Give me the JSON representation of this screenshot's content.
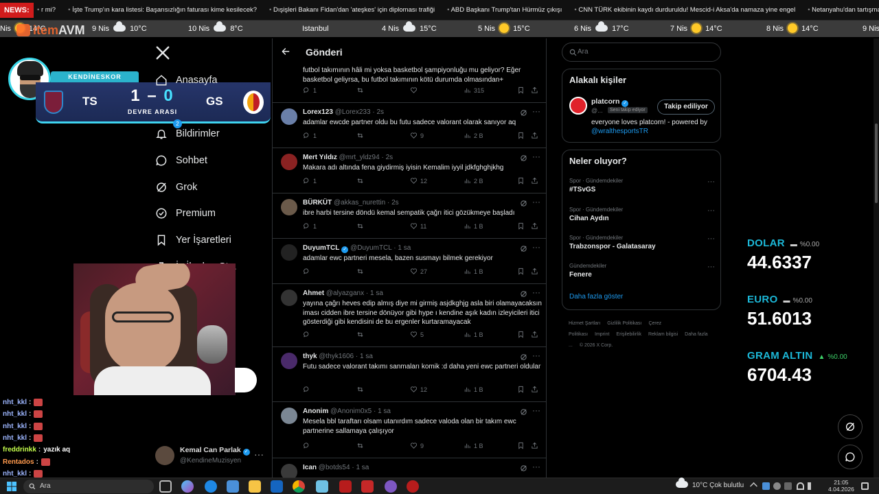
{
  "news": {
    "label": "NEWS:",
    "items": [
      "r mi?",
      "İşte Trump'ın kara listesi: Başarısızlığın faturası kime kesilecek?",
      "Dışişleri Bakanı Fidan'dan 'ateşkes' için diploması trafiği",
      "ABD Başkanı Trump'tan Hürmüz çıkışı",
      "CNN TÜRK ekibinin kaydı durduruldu! Mescid-i Aksa'da namaza yine engel",
      "Netanyahu'dan tartışma yaratacak sözler: \"Altyapıları bombalıyo"
    ]
  },
  "weather": [
    {
      "day": "Nis",
      "temp": "14°C",
      "icon": "sun-icon"
    },
    {
      "day": "9 Nis",
      "temp": "10°C",
      "icon": "cloud-icon"
    },
    {
      "day": "10 Nis",
      "temp": "8°C",
      "icon": "cloud-icon"
    },
    {
      "day": "Istanbul",
      "temp": "",
      "icon": ""
    },
    {
      "day": "4 Nis",
      "temp": "15°C",
      "icon": "cloud-icon"
    },
    {
      "day": "5 Nis",
      "temp": "15°C",
      "icon": "sun-icon"
    },
    {
      "day": "6 Nis",
      "temp": "17°C",
      "icon": "cloud-icon"
    },
    {
      "day": "7 Nis",
      "temp": "14°C",
      "icon": "sun-icon"
    },
    {
      "day": "8 Nis",
      "temp": "14°C",
      "icon": "sun-icon"
    },
    {
      "day": "9 Nis",
      "temp": "",
      "icon": "cloud-icon"
    }
  ],
  "overlay": {
    "logo_item": "item",
    "logo_avm": "AVM",
    "score_title": "KENDİNESKOR",
    "home_team": "TS",
    "away_team": "GS",
    "home_score": "1",
    "away_score": "0",
    "status": "DEVRE ARASI"
  },
  "nav": {
    "items": [
      {
        "label": "Anasayfa",
        "icon": "home-icon"
      },
      {
        "label": "Bildirimler",
        "icon": "bell-icon",
        "badge": "2"
      },
      {
        "label": "Sohbet",
        "icon": "chat-icon"
      },
      {
        "label": "Grok",
        "icon": "grok-icon"
      },
      {
        "label": "Premium",
        "icon": "premium-icon"
      },
      {
        "label": "Yer İşaretleri",
        "icon": "bookmark-icon"
      },
      {
        "label": "İş İlanları St...",
        "icon": "briefcase-icon"
      }
    ],
    "account_name": "Kemal Can Parlak",
    "account_handle": "@KendineMuzisyen",
    "account_more": "···"
  },
  "chat": [
    {
      "user": "nht_kkl",
      "msg": "",
      "cls": ""
    },
    {
      "user": "nht_kkl",
      "msg": "",
      "cls": ""
    },
    {
      "user": "nht_kkl",
      "msg": "",
      "cls": ""
    },
    {
      "user": "nht_kkl",
      "msg": "",
      "cls": ""
    },
    {
      "user": "freddrinkk",
      "msg": "yazık aq",
      "cls": "c2"
    },
    {
      "user": "Rentados",
      "msg": "",
      "cls": "c3"
    },
    {
      "user": "nht_kkl",
      "msg": "",
      "cls": ""
    }
  ],
  "timeline": {
    "title": "Gönderi",
    "tweets": [
      {
        "name": "",
        "handle": "",
        "time": "",
        "verified": false,
        "avatar": "#444",
        "text": "futbol takımının hâli mi yoksa basketbol şampiyonluğu mu geliyor? Eğer basketbol geliyrsa, bu futbol takımının kötü durumda olmasından+",
        "replies": "1",
        "retweets": "",
        "likes": "",
        "views": "315"
      },
      {
        "name": "Lorex123",
        "handle": "@Lorex233",
        "time": "2s",
        "verified": false,
        "avatar": "#6a7fa8",
        "text": "adamlar ewcde partner oldu bu futu  sadece valorant olarak sanıyor aq",
        "replies": "1",
        "retweets": "",
        "likes": "9",
        "views": "2 B"
      },
      {
        "name": "Mert Yıldız",
        "handle": "@mrt_yldz94",
        "time": "2s",
        "verified": false,
        "avatar": "#8a2222",
        "text": "Makara adı altında fena giydirmiş iyisin Kemalim iyyil jdkfghghjkhg",
        "replies": "1",
        "retweets": "",
        "likes": "12",
        "views": "2 B"
      },
      {
        "name": "BÜRKÜT",
        "handle": "@akkas_nurettin",
        "time": "2s",
        "verified": false,
        "avatar": "#6b5a4a",
        "text": "ibre harbi tersine döndü kemal sempatik çağrı itici gözükmeye başladı",
        "replies": "1",
        "retweets": "",
        "likes": "11",
        "views": "1 B"
      },
      {
        "name": "DuyumTCL",
        "handle": "@DuyumTCL",
        "time": "1 sa",
        "verified": true,
        "avatar": "#222",
        "text": "adamlar ewc partneri mesela, bazen susmayı bilmek gerekiyor",
        "replies": "",
        "retweets": "",
        "likes": "27",
        "views": "1 B"
      },
      {
        "name": "Ahmet",
        "handle": "@alyazganx",
        "time": "1 sa",
        "verified": false,
        "avatar": "#333",
        "text": "yayına çağrı heves edip almış diye mi girmiş asjdkghjg asla biri olamayacaksın iması cidden ibre tersine dönüyor gibi hype ı kendine aşık kadın izleyicileri itici gösterdiği gibi kendisini de bu ergenler kurtaramayacak",
        "replies": "",
        "retweets": "",
        "likes": "5",
        "views": "1 B"
      },
      {
        "name": "thyk",
        "handle": "@thyk1606",
        "time": "1 sa",
        "verified": false,
        "avatar": "#4a2a6a",
        "text": "Futu sadece valorant takımı sanmaları komik :d daha yeni ewc partneri oldular",
        "replies": "",
        "retweets": "",
        "likes": "12",
        "views": "1 B"
      },
      {
        "name": "Anonim",
        "handle": "@Anonim0x5",
        "time": "1 sa",
        "verified": false,
        "avatar": "#7b8794",
        "text": "Mesela bbl taraftarı olsam utanırdım sadece valoda olan bir takım ewc partnerine sallamaya çalışıyor",
        "replies": "",
        "retweets": "",
        "likes": "9",
        "views": "1 B"
      },
      {
        "name": "Ican",
        "handle": "@botds54",
        "time": "1 sa",
        "verified": false,
        "avatar": "#3a3a3a",
        "text": "",
        "replies": "",
        "retweets": "",
        "likes": "",
        "views": ""
      }
    ]
  },
  "right": {
    "search_placeholder": "Ara",
    "people_title": "Alakalı kişiler",
    "person_name": "platcorn",
    "person_handle": "@...",
    "person_follows_you": "Seni takip ediyor",
    "follow_label": "Takip ediliyor",
    "person_bio": "everyone loves platcorn! - powered by ",
    "person_bio_mention": "@wralthesportsTR",
    "trends_title": "Neler oluyor?",
    "trends": [
      {
        "cat": "Spor · Gündemdekiler",
        "name": "#TSvGS"
      },
      {
        "cat": "Spor · Gündemdekiler",
        "name": "Cihan Aydın"
      },
      {
        "cat": "Spor · Gündemdekiler",
        "name": "Trabzonspor - Galatasaray"
      },
      {
        "cat": "Gündemdekiler",
        "name": "Fenere"
      }
    ],
    "show_more": "Daha fazla göster",
    "footer": [
      "Hizmet Şartları",
      "Gizlilik Politikası",
      "Çerez Politikası",
      "Imprint",
      "Erişilebilirlik",
      "Reklam bilgisi",
      "Daha fazla ...",
      "© 2026 X Corp."
    ]
  },
  "currency": [
    {
      "name": "DOLAR",
      "arrow": "▬",
      "change": "%0.00",
      "value": "44.6337",
      "up": false
    },
    {
      "name": "EURO",
      "arrow": "▬",
      "change": "%0.00",
      "value": "51.6013",
      "up": false
    },
    {
      "name": "GRAM ALTIN",
      "arrow": "▲",
      "change": "%0.00",
      "value": "6704.43",
      "up": true
    }
  ],
  "taskbar": {
    "search": "Ara",
    "weather": "10°C  Çok bulutlu",
    "time": "21:05",
    "date": "4.04.2026"
  }
}
